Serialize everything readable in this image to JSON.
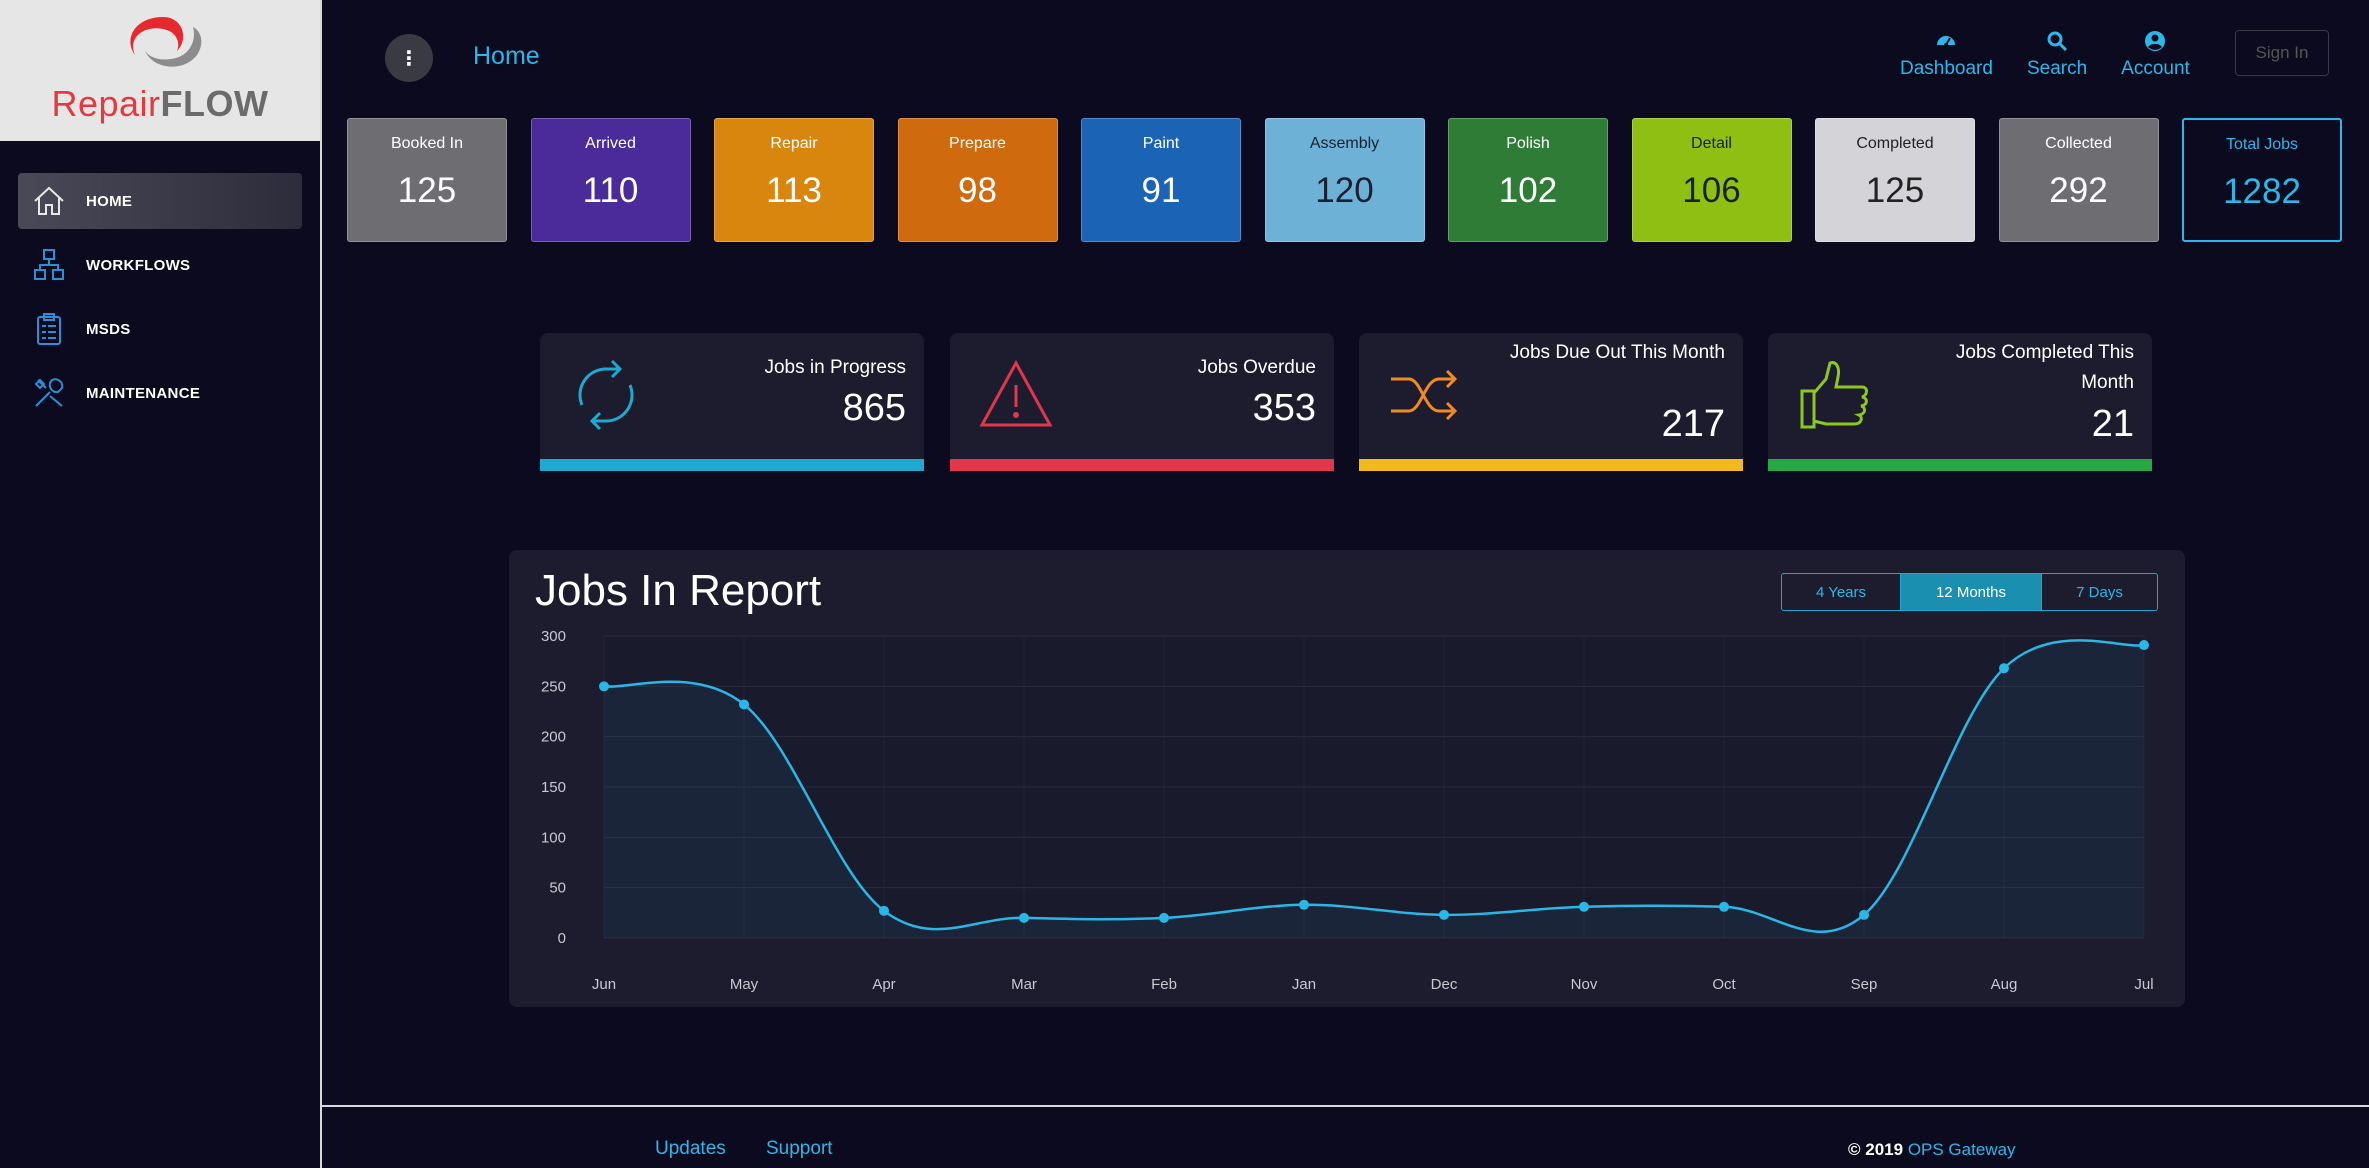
{
  "brand": {
    "name_part1": "Repair",
    "name_part2": "FLOW"
  },
  "sidebar": {
    "items": [
      {
        "label": "HOME",
        "icon": "home-icon"
      },
      {
        "label": "WORKFLOWS",
        "icon": "workflow-icon"
      },
      {
        "label": "MSDS",
        "icon": "clipboard-icon"
      },
      {
        "label": "MAINTENANCE",
        "icon": "tools-icon"
      }
    ]
  },
  "header": {
    "menu_glyph": "⋮",
    "title": "Home",
    "links": [
      {
        "label": "Dashboard",
        "icon": "dashboard-icon"
      },
      {
        "label": "Search",
        "icon": "search-icon"
      },
      {
        "label": "Account",
        "icon": "account-icon"
      }
    ],
    "signin": "Sign In"
  },
  "tiles": [
    {
      "label": "Booked In",
      "value": "125",
      "bg": "#6e6d72",
      "fg": "#ffffff"
    },
    {
      "label": "Arrived",
      "value": "110",
      "bg": "#4b2a99",
      "fg": "#ffffff"
    },
    {
      "label": "Repair",
      "value": "113",
      "bg": "#d9860f",
      "fg": "#ffffff"
    },
    {
      "label": "Prepare",
      "value": "98",
      "bg": "#cf6a0e",
      "fg": "#ffffff"
    },
    {
      "label": "Paint",
      "value": "91",
      "bg": "#1b63b5",
      "fg": "#ffffff"
    },
    {
      "label": "Assembly",
      "value": "120",
      "bg": "#6db1d6",
      "fg": "#1b2030"
    },
    {
      "label": "Polish",
      "value": "102",
      "bg": "#2f7c37",
      "fg": "#ffffff"
    },
    {
      "label": "Detail",
      "value": "106",
      "bg": "#90bf13",
      "fg": "#1b2030"
    },
    {
      "label": "Completed",
      "value": "125",
      "bg": "#d4d4d8",
      "fg": "#222222"
    },
    {
      "label": "Collected",
      "value": "292",
      "bg": "#6e6d72",
      "fg": "#ffffff"
    },
    {
      "label": "Total Jobs",
      "value": "1282",
      "bg": "transparent",
      "fg": "#2bb8e8"
    }
  ],
  "cards": [
    {
      "title": "Jobs in Progress",
      "value": "865",
      "bar": "#1da9d0",
      "icon": "refresh-icon",
      "icon_color": "#1da9d0"
    },
    {
      "title": "Jobs Overdue",
      "value": "353",
      "bar": "#e0374d",
      "icon": "warning-icon",
      "icon_color": "#e0374d"
    },
    {
      "title": "Jobs Due Out This Month",
      "value": "217",
      "bar": "#f2b81c",
      "icon": "shuffle-icon",
      "icon_color": "#f08a22"
    },
    {
      "title": "Jobs Completed This Month",
      "value": "21",
      "bar": "#27a844",
      "icon": "thumbs-up-icon",
      "icon_color": "#8cc81d"
    }
  ],
  "report": {
    "title": "Jobs In Report",
    "ranges": [
      {
        "label": "4 Years",
        "active": false
      },
      {
        "label": "12 Months",
        "active": true
      },
      {
        "label": "7 Days",
        "active": false
      }
    ]
  },
  "chart_data": {
    "type": "area",
    "title": "Jobs In Report",
    "categories": [
      "Jun",
      "May",
      "Apr",
      "Mar",
      "Feb",
      "Jan",
      "Dec",
      "Nov",
      "Oct",
      "Sep",
      "Aug",
      "Jul"
    ],
    "series": [
      {
        "values": [
          250,
          232,
          27,
          20,
          20,
          33,
          23,
          31,
          31,
          23,
          268,
          291
        ]
      }
    ],
    "yticks": [
      0,
      50,
      100,
      150,
      200,
      250,
      300
    ],
    "ylim": [
      0,
      300
    ],
    "line_color": "#29b7e6",
    "grid": true
  },
  "footer": {
    "links": [
      "Updates",
      "Support"
    ],
    "copyright_prefix": "© 2019",
    "copyright_org": "OPS Gateway"
  }
}
